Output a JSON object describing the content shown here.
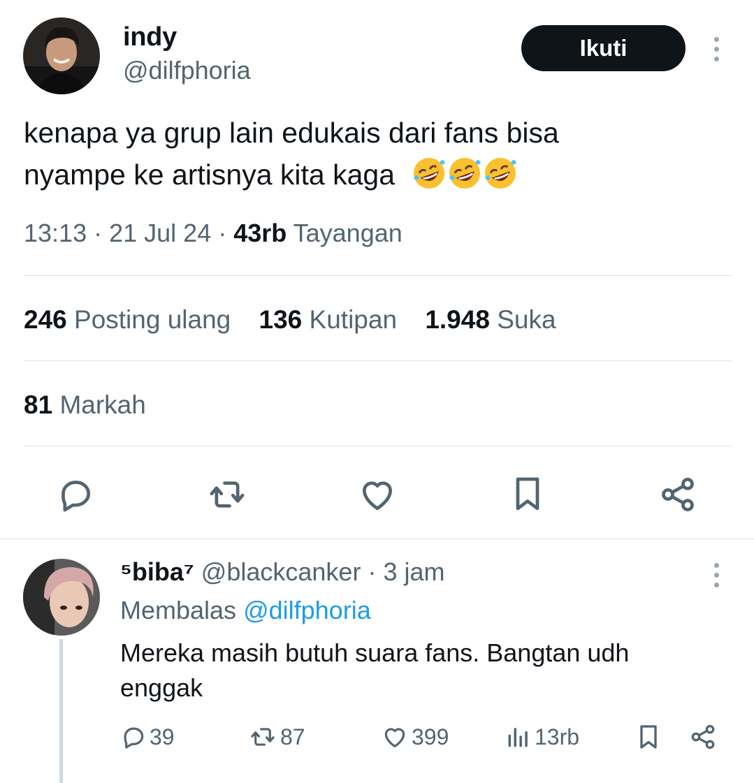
{
  "tweet": {
    "author_name": "indy",
    "author_handle": "@dilfphoria",
    "follow_label": "Ikuti",
    "text_line1": "kenapa ya grup lain edukais dari fans bisa",
    "text_line2": "nyampe ke artisnya kita kaga",
    "emoji_count": 3,
    "time": "13:13",
    "date": "21 Jul 24",
    "views_count": "43rb",
    "views_label": "Tayangan"
  },
  "stats": {
    "reposts_count": "246",
    "reposts_label": "Posting ulang",
    "quotes_count": "136",
    "quotes_label": "Kutipan",
    "likes_count": "1.948",
    "likes_label": "Suka",
    "bookmarks_count": "81",
    "bookmarks_label": "Markah"
  },
  "actions": [
    "reply-icon",
    "repost-icon",
    "like-icon",
    "bookmark-icon",
    "share-icon"
  ],
  "reply": {
    "author_name": "⁵biba⁷",
    "author_handle": "@blackcanker",
    "time_ago": "3 jam",
    "replying_prefix": "Membalas",
    "replying_to": "@dilfphoria",
    "text": "Mereka masih butuh suara fans. Bangtan udh enggak",
    "replies": "39",
    "reposts": "87",
    "likes": "399",
    "views": "13rb"
  },
  "colors": {
    "text": "#0f1419",
    "secondary": "#536471",
    "link": "#1d9bf0",
    "divider": "#dde2e6",
    "button_bg": "#0f1419"
  }
}
